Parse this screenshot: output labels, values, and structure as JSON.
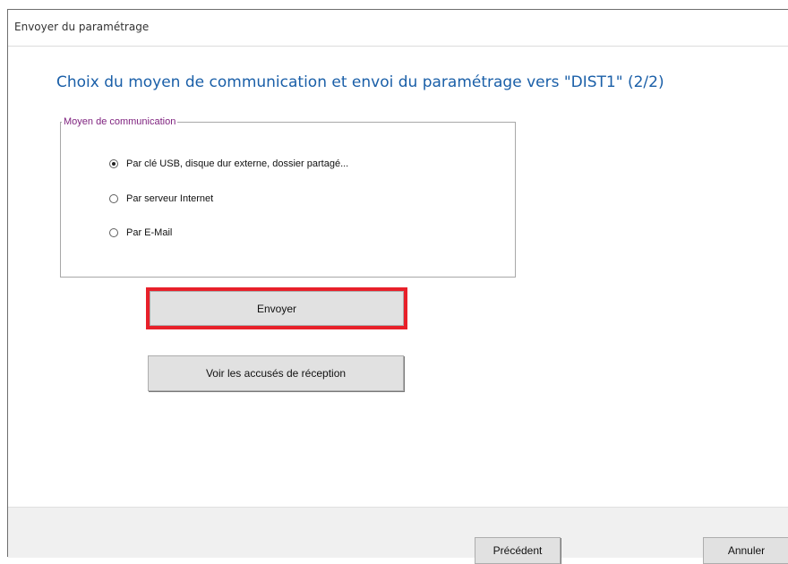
{
  "window": {
    "title": "Envoyer du paramétrage"
  },
  "header": {
    "heading": "Choix du moyen de communication et envoi du paramétrage vers \"DIST1\" (2/2)"
  },
  "communication_group": {
    "legend": "Moyen de communication",
    "options": [
      {
        "label": "Par clé USB, disque dur externe, dossier partagé...",
        "selected": true
      },
      {
        "label": "Par serveur Internet",
        "selected": false
      },
      {
        "label": "Par E-Mail",
        "selected": false
      }
    ]
  },
  "actions": {
    "send_label": "Envoyer",
    "receipts_label": "Voir les accusés de réception"
  },
  "footer": {
    "previous_label": "Précédent",
    "cancel_label": "Annuler"
  },
  "colors": {
    "heading": "#1a5fa8",
    "legend": "#7d1f7d",
    "highlight": "#e8202a"
  }
}
